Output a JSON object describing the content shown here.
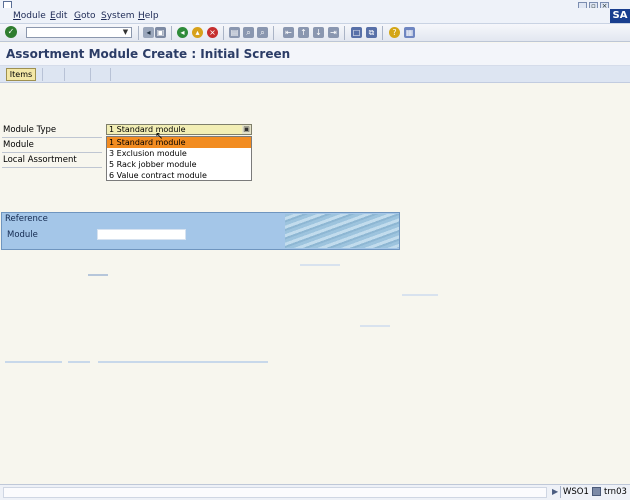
{
  "menu": {
    "items": [
      {
        "label": "Module",
        "underline": "M"
      },
      {
        "label": "Edit",
        "underline": "E"
      },
      {
        "label": "Goto",
        "underline": "G"
      },
      {
        "label": "System",
        "underline": "S"
      },
      {
        "label": "Help",
        "underline": "H"
      }
    ]
  },
  "window_controls": [
    "minimize-icon",
    "restore-icon",
    "close-icon"
  ],
  "brand": {
    "logo_text": "SA"
  },
  "toolbar": {
    "command_field_value": "",
    "icons": [
      "enter-icon",
      "command-dropdown-icon",
      "back-icon",
      "save-icon",
      "green-back-icon",
      "exit-icon",
      "cancel-icon",
      "print-icon",
      "find-icon",
      "find-next-icon",
      "first-page-icon",
      "previous-page-icon",
      "next-page-icon",
      "last-page-icon",
      "create-session-icon",
      "shortcut-icon",
      "help-icon",
      "layout-icon"
    ]
  },
  "page": {
    "title": "Assortment Module  Create : Initial Screen"
  },
  "app_toolbar": {
    "items_button": "Items"
  },
  "fields": {
    "module_type_label": "Module Type",
    "module_label": "Module",
    "local_assortment_label": "Local Assortment",
    "module_type_value": "1 Standard module"
  },
  "dropdown": {
    "options": [
      {
        "label": "1 Standard module",
        "selected": true
      },
      {
        "label": "3 Exclusion module",
        "selected": false
      },
      {
        "label": "5 Rack jobber module",
        "selected": false
      },
      {
        "label": "6 Value contract module",
        "selected": false
      }
    ]
  },
  "reference": {
    "title": "Reference",
    "module_label": "Module",
    "module_value": ""
  },
  "status": {
    "message": "",
    "system": "WSO1",
    "server": "trn03"
  },
  "colors": {
    "accent": "#f28c21",
    "reference_bg": "#a4c6e8",
    "title_text": "#2b3c66",
    "background": "#f7f6ee"
  }
}
